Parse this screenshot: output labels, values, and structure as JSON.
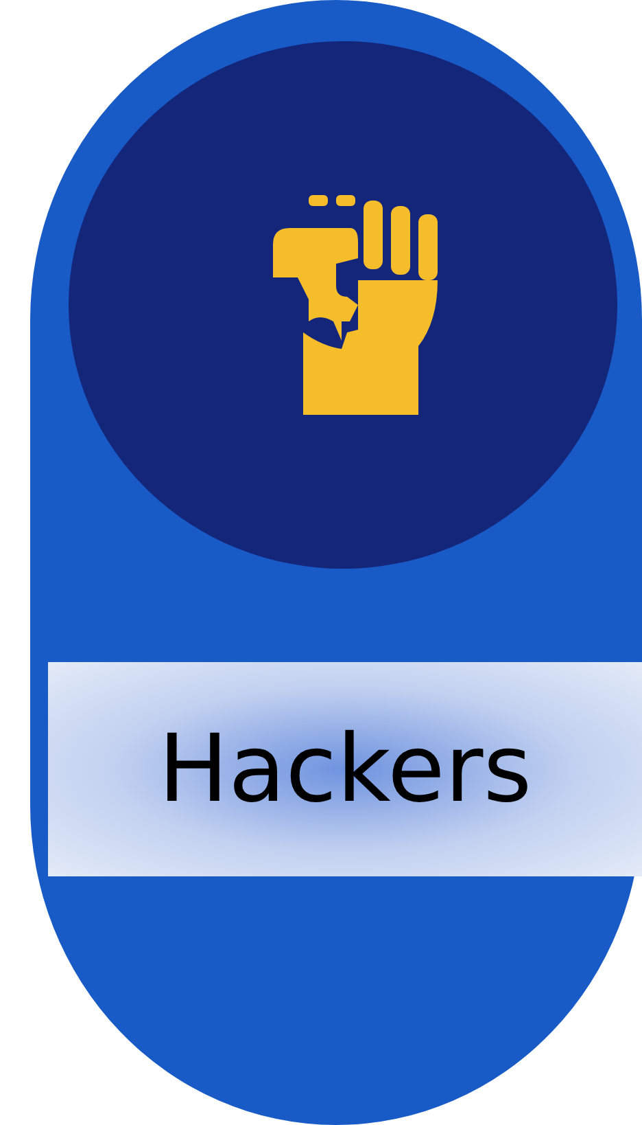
{
  "card": {
    "label": "Hackers"
  }
}
